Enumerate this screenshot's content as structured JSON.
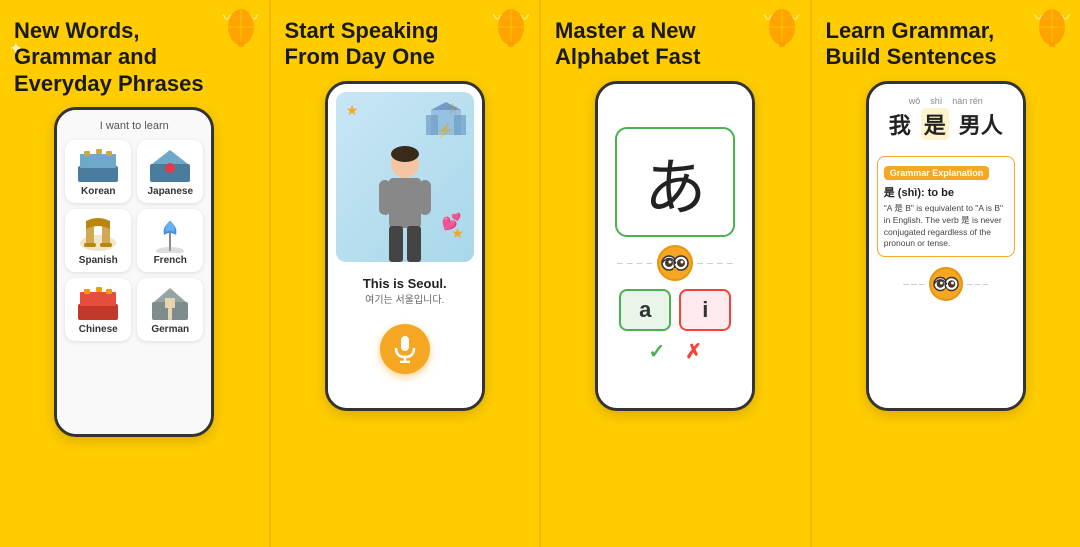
{
  "panels": [
    {
      "id": "panel1",
      "title": "New Words,\nGrammar and\nEveryday Phrases",
      "screen_label": "I want to learn",
      "languages": [
        {
          "name": "Korean",
          "icon": "🏯"
        },
        {
          "name": "Japanese",
          "icon": "⛩️"
        },
        {
          "name": "Spanish",
          "icon": "🏛️"
        },
        {
          "name": "French",
          "icon": "🗼"
        },
        {
          "name": "Chinese",
          "icon": "🏯"
        },
        {
          "name": "German",
          "icon": "🏰"
        }
      ]
    },
    {
      "id": "panel2",
      "title": "Start Speaking\nFrom Day One",
      "subtitle_en": "This is Seoul.",
      "subtitle_ko": "여기는 서울입니다.",
      "mic_icon": "🎤"
    },
    {
      "id": "panel3",
      "title": "Master a New\nAlphabet Fast",
      "character": "あ",
      "answer_a": "a",
      "answer_i": "i",
      "check_correct": "✓",
      "check_wrong": "✗"
    },
    {
      "id": "panel4",
      "title": "Learn Grammar,\nBuild Sentences",
      "pinyin": [
        "wǒ",
        "shì",
        "nán rén"
      ],
      "hanzi": [
        "我",
        "是",
        "男人"
      ],
      "grammar_box_title": "Grammar Explanation",
      "grammar_word": "是 (shì): to be",
      "grammar_desc": "\"A 是 B\" is equivalent to \"A is B\" in\nEnglish. The verb 是 is never conjugated\nregardless of the pronoun or tense."
    }
  ],
  "colors": {
    "background": "#ffcc00",
    "accent_orange": "#f5a623",
    "correct_green": "#4CAF50",
    "wrong_red": "#f44336",
    "white": "#ffffff"
  }
}
